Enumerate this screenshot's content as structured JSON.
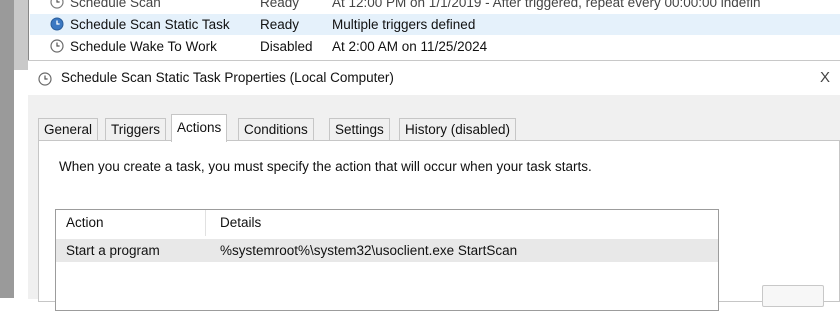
{
  "background_window": {
    "tasks": [
      {
        "name": "Schedule Scan",
        "status": "Ready",
        "trigger": "At 12:00 PM on 1/1/2019 - After triggered, repeat every 00:00:00 indefin"
      },
      {
        "name": "Schedule Scan Static Task",
        "status": "Ready",
        "trigger": "Multiple triggers defined"
      },
      {
        "name": "Schedule Wake To Work",
        "status": "Disabled",
        "trigger": "At 2:00 AM on 11/25/2024"
      }
    ]
  },
  "dialog": {
    "title": "Schedule Scan Static Task Properties (Local Computer)",
    "close_label": "X",
    "tabs": [
      {
        "label": "General"
      },
      {
        "label": "Triggers"
      },
      {
        "label": "Actions"
      },
      {
        "label": "Conditions"
      },
      {
        "label": "Settings"
      },
      {
        "label": "History (disabled)"
      }
    ],
    "active_tab": "Actions",
    "instruction": "When you create a task, you must specify the action that will occur when your task starts.",
    "table": {
      "headers": [
        "Action",
        "Details"
      ],
      "rows": [
        {
          "action": "Start a program",
          "details": "%systemroot%\\system32\\usoclient.exe StartScan"
        }
      ]
    }
  },
  "colors": {
    "selected_row": "#e5f1fb",
    "dialog_bg": "#f0f0f0",
    "clock_icon": "#3b78c2"
  }
}
